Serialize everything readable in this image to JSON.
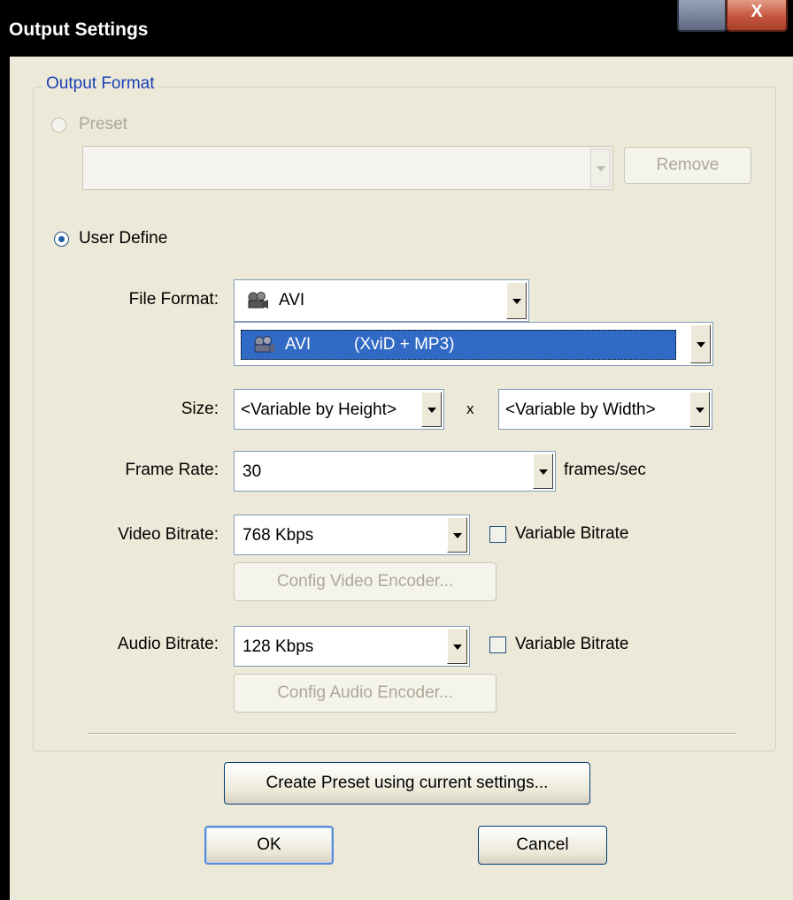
{
  "window": {
    "title": "Output Settings",
    "close_glyph": "X"
  },
  "output_format": {
    "group_label": "Output Format",
    "preset": {
      "label": "Preset",
      "value": "",
      "remove_label": "Remove"
    },
    "user_define": {
      "label": "User Define"
    }
  },
  "fields": {
    "file_format": {
      "label": "File Format:",
      "value": "AVI",
      "codec_name": "AVI",
      "codec_detail": "(XviD + MP3)",
      "icon": "film-reel-icon"
    },
    "size": {
      "label": "Size:",
      "height_value": "<Variable by Height>",
      "separator": "x",
      "width_value": "<Variable by Width>"
    },
    "frame_rate": {
      "label": "Frame Rate:",
      "value": "30",
      "unit": "frames/sec"
    },
    "video_bitrate": {
      "label": "Video Bitrate:",
      "value": "768 Kbps",
      "variable_label": "Variable Bitrate",
      "config_label": "Config Video Encoder..."
    },
    "audio_bitrate": {
      "label": "Audio Bitrate:",
      "value": "128 Kbps",
      "variable_label": "Variable Bitrate",
      "config_label": "Config Audio Encoder..."
    }
  },
  "actions": {
    "create_preset_label": "Create Preset using current settings...",
    "ok_label": "OK",
    "cancel_label": "Cancel"
  },
  "colors": {
    "dialog_bg": "#ece9d8",
    "selection": "#316ac5",
    "group_label": "#1c3fb5"
  }
}
